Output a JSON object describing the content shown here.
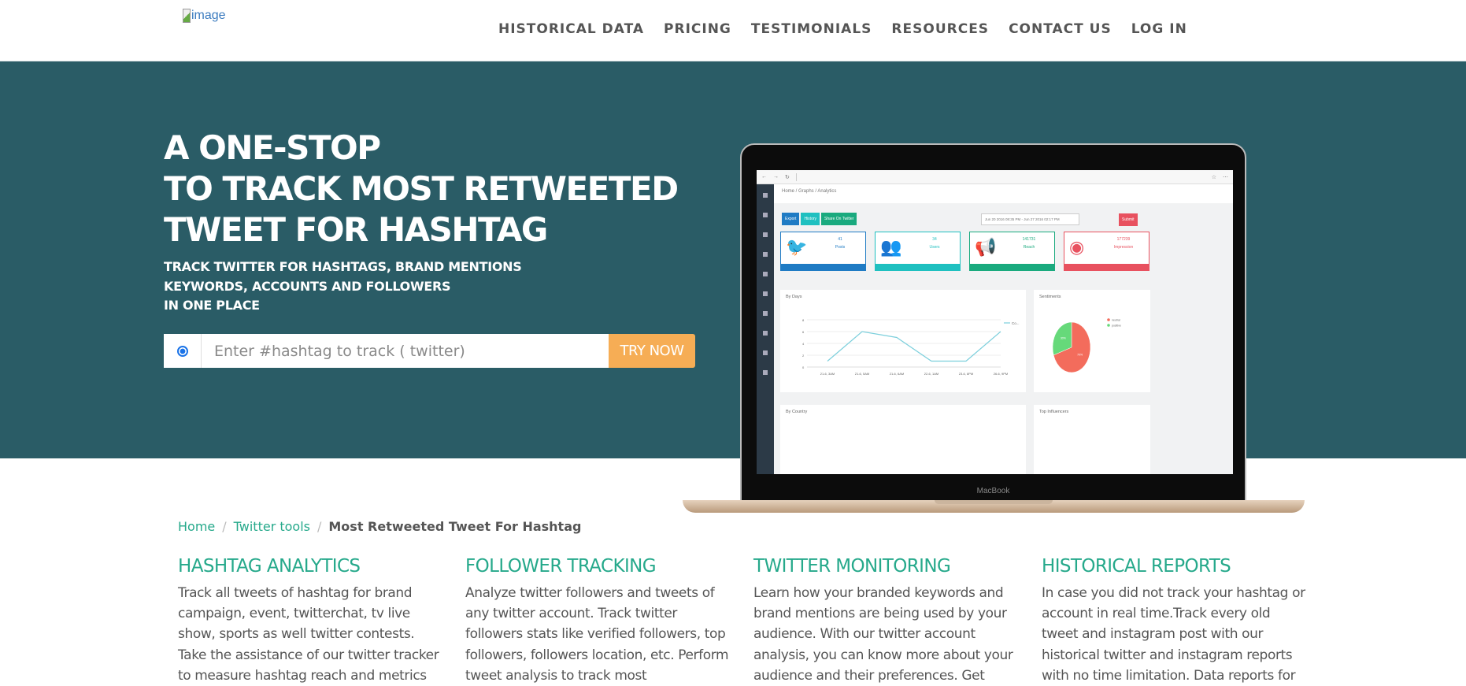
{
  "header": {
    "logo_alt": "image",
    "nav": [
      "HISTORICAL DATA",
      "PRICING",
      "TESTIMONIALS",
      "RESOURCES",
      "CONTACT US",
      "LOG IN"
    ]
  },
  "hero": {
    "title_lines": [
      "A ONE-STOP",
      "TO TRACK MOST RETWEETED",
      "TWEET FOR HASHTAG"
    ],
    "subtitle_lines": [
      "TRACK TWITTER FOR HASHTAGS, BRAND MENTIONS",
      "KEYWORDS, ACCOUNTS AND FOLLOWERS",
      "IN ONE PLACE"
    ],
    "search_placeholder": "Enter #hashtag to track ( twitter)",
    "search_value": "",
    "try_label": "TRY NOW",
    "colors": {
      "background": "#2a5c66",
      "button": "#f6ad55"
    },
    "laptop": {
      "brand": "MacBook",
      "breadcrumb": "Home / Graphs / Analytics",
      "buttons": [
        "Export",
        "History",
        "Share On Twitter"
      ],
      "date_range": "Jun 20 2016 08:35 PM - Jun 27 2016 02:17 PM",
      "submit": "Submit",
      "stats": [
        {
          "icon": "twitter-bird-icon",
          "value": "41",
          "label": "Posts",
          "color": "#1f7bc4"
        },
        {
          "icon": "users-icon",
          "value": "34",
          "label": "Users",
          "color": "#1fc0c0"
        },
        {
          "icon": "megaphone-icon",
          "value": "141731",
          "label": "Reach",
          "color": "#1aaa7e"
        },
        {
          "icon": "eye-icon",
          "value": "177239",
          "label": "Impression",
          "color": "#e8515f"
        }
      ],
      "by_days": {
        "title": "By Days",
        "legend": "Co...",
        "x": [
          "21-6, 3AM",
          "21-6, 5AM",
          "21-6, 6AM",
          "22-6, 1AM",
          "23-6, 8PM",
          "26-6, 9PM"
        ],
        "y": [
          1,
          6,
          5,
          1,
          1,
          6
        ],
        "yticks": [
          0,
          2,
          4,
          6,
          8
        ]
      },
      "sentiments": {
        "title": "Sentiments",
        "legend": [
          "neutral",
          "positive"
        ],
        "values": [
          70,
          30
        ],
        "colors": [
          "#f36c5c",
          "#66d97a"
        ]
      },
      "by_country_title": "By Country",
      "top_influencers_title": "Top Influencers"
    }
  },
  "breadcrumb": {
    "home": "Home",
    "section": "Twitter tools",
    "current": "Most Retweeted Tweet For Hashtag"
  },
  "features": [
    {
      "title": "HASHTAG ANALYTICS",
      "text": "Track all tweets of hashtag for brand campaign, event, twitterchat, tv live show, sports as well twitter contests. Take the assistance of our twitter tracker to measure hashtag reach and metrics"
    },
    {
      "title": "FOLLOWER TRACKING",
      "text": "Analyze twitter followers and tweets of any twitter account. Track twitter followers stats like verified followers, top followers, followers location, etc. Perform tweet analysis to track most"
    },
    {
      "title": "TWITTER MONITORING",
      "text": "Learn how your branded keywords and brand mentions are being used by your audience. With our twitter account analysis, you can know more about your audience and their preferences. Get"
    },
    {
      "title": "HISTORICAL REPORTS",
      "text": "In case you did not track your hashtag or account in real time.Track every old tweet and instagram post with our historical twitter and instagram reports with no time limitation. Data reports for"
    }
  ]
}
